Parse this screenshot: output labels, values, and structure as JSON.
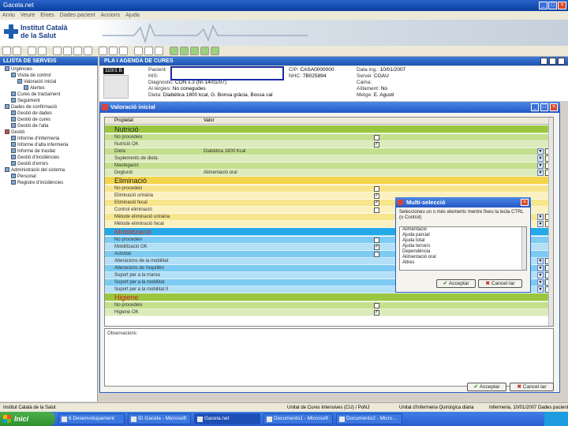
{
  "window": {
    "title": "Gacela.net"
  },
  "menu": [
    "Arxiu",
    "Veure",
    "Eines",
    "Dades pacient",
    "Accions",
    "Ajuda"
  ],
  "brand": {
    "line1": "Institut Català",
    "line2": "de la Salut"
  },
  "left_panel": {
    "title": "LLISTA DE SERVEIS",
    "tree": [
      "Urgències",
      "Visita de control",
      "Valoració inicial",
      "Alertes",
      "Cures de tractament",
      "Seguiment",
      "Dades de confirmació",
      "Gestió de dades",
      "Gestió de cures",
      "Gestió de l'alta",
      "Gestió",
      "Informe d'infermeria",
      "Informe d'alta infermeria",
      "Informe de trasllat",
      "Gestió d'incidències",
      "Gestió d'errors",
      "Administració del sistema",
      "Personal",
      "Registre d'incidències"
    ]
  },
  "main": {
    "title": "PLA I AGENDA DE CURES",
    "patient": {
      "badge": "110/1 B",
      "pacient_label": "Pacient:",
      "his_label": "HIS:",
      "his_value": "",
      "diagnostic_label": "Diagnòstic:",
      "diagnostic_value": "CON s.3 (fin 14/01/07)",
      "alergies_label": "Al·lèrgies:",
      "alergies_value": "No conegudes",
      "dieta_label": "Dieta:",
      "dieta_value": "Diabètica 1800 kcal, G. Bonsa gràcia, Bossa cal",
      "cip_label": "CIP:",
      "cip_value": "CASA0000000",
      "nhc_label": "NHC:",
      "nhc_value": "7B025894",
      "data_label": "Data ing.:",
      "data_value": "10/01/2007",
      "servei_label": "Servei:",
      "servei_value": "CGAU",
      "cama_label": "Cama:",
      "cama_value": "",
      "aillament_label": "Aïllament:",
      "aillament_value": "No",
      "metge_label": "Metge:",
      "metge_value": "E. Agustí"
    }
  },
  "dialog": {
    "title": "Valoració inicial",
    "columns": {
      "property": "Propietat",
      "value": "Valor"
    },
    "sections": [
      {
        "name": "Nutrició",
        "color": "#9ac640",
        "rows": [
          {
            "label": "No procedeix",
            "value": "",
            "check": "none"
          },
          {
            "label": "Nutrició OK",
            "value": "",
            "check": "checked"
          },
          {
            "label": "Dieta",
            "value": "Diabètica 1800 Kcal",
            "check": ""
          },
          {
            "label": "Suplements de dieta",
            "value": "",
            "check": ""
          },
          {
            "label": "Mastegació",
            "value": "",
            "check": ""
          },
          {
            "label": "Deglució",
            "value": "Alimentació oral",
            "check": ""
          }
        ]
      },
      {
        "name": "Eliminació",
        "color": "#f4d44a",
        "rows": [
          {
            "label": "No procedeix",
            "value": "",
            "check": "none"
          },
          {
            "label": "Eliminació urinària",
            "value": "",
            "check": "checked"
          },
          {
            "label": "Eliminació fecal",
            "value": "",
            "check": "checked"
          },
          {
            "label": "Control eliminació",
            "value": "",
            "check": "none"
          },
          {
            "label": "Mètode eliminació urinària",
            "value": "",
            "check": ""
          },
          {
            "label": "Mètode eliminació fecal",
            "value": "",
            "check": ""
          }
        ]
      },
      {
        "name": "Mobilització",
        "color": "#24a9e8",
        "rows": [
          {
            "label": "No procedeix",
            "value": "",
            "check": "none"
          },
          {
            "label": "Mobilització OK",
            "value": "",
            "check": "checked"
          },
          {
            "label": "Activitat",
            "value": "",
            "check": "none"
          },
          {
            "label": "Alteracions de la mobilitat",
            "value": "",
            "check": ""
          },
          {
            "label": "Alteracions de l'equilibri",
            "value": "",
            "check": ""
          },
          {
            "label": "Suport per a la marxa",
            "value": "",
            "check": ""
          },
          {
            "label": "Suport per a la mobilitat",
            "value": "",
            "check": ""
          },
          {
            "label": "Suport per a la mobilitat II",
            "value": "",
            "check": ""
          }
        ]
      },
      {
        "name": "Higiene",
        "color": "#9ac640",
        "rows": [
          {
            "label": "No procedeix",
            "value": "",
            "check": "none"
          },
          {
            "label": "Higiene OK",
            "value": "",
            "check": "checked"
          }
        ]
      }
    ],
    "observations_label": "Observacions:",
    "accept": "Acceptar",
    "cancel": "Cancel·lar"
  },
  "multi_dialog": {
    "title": "Multi-selecció",
    "description": "Seleccioneu un o més elements mentre fixeu la tecla CTRL (o Control)",
    "items": [
      "Alimentació",
      "Ajuda parcial",
      "Ajuda total",
      "Ajuda tercers",
      "Dependència",
      "Alimentació oral",
      "Altres"
    ],
    "accept": "Acceptar",
    "cancel": "Cancel·lar"
  },
  "statusbar": {
    "left": "Institut Català de la Salut",
    "middle": "Unitat de Cures Intensives (CU) / PoNJ",
    "middle2": "Unitat d'Infermeria Quirúrgica diària",
    "right": "Infermeria, 10/01/2007 Dades pacient"
  },
  "taskbar": {
    "start": "Inici",
    "tasks": [
      "6 Desenvolupament",
      "ID Gacela - Microsoft",
      "Gacela.net",
      "Documento1 - Microsoft",
      "Documento2 - Micro..."
    ]
  }
}
